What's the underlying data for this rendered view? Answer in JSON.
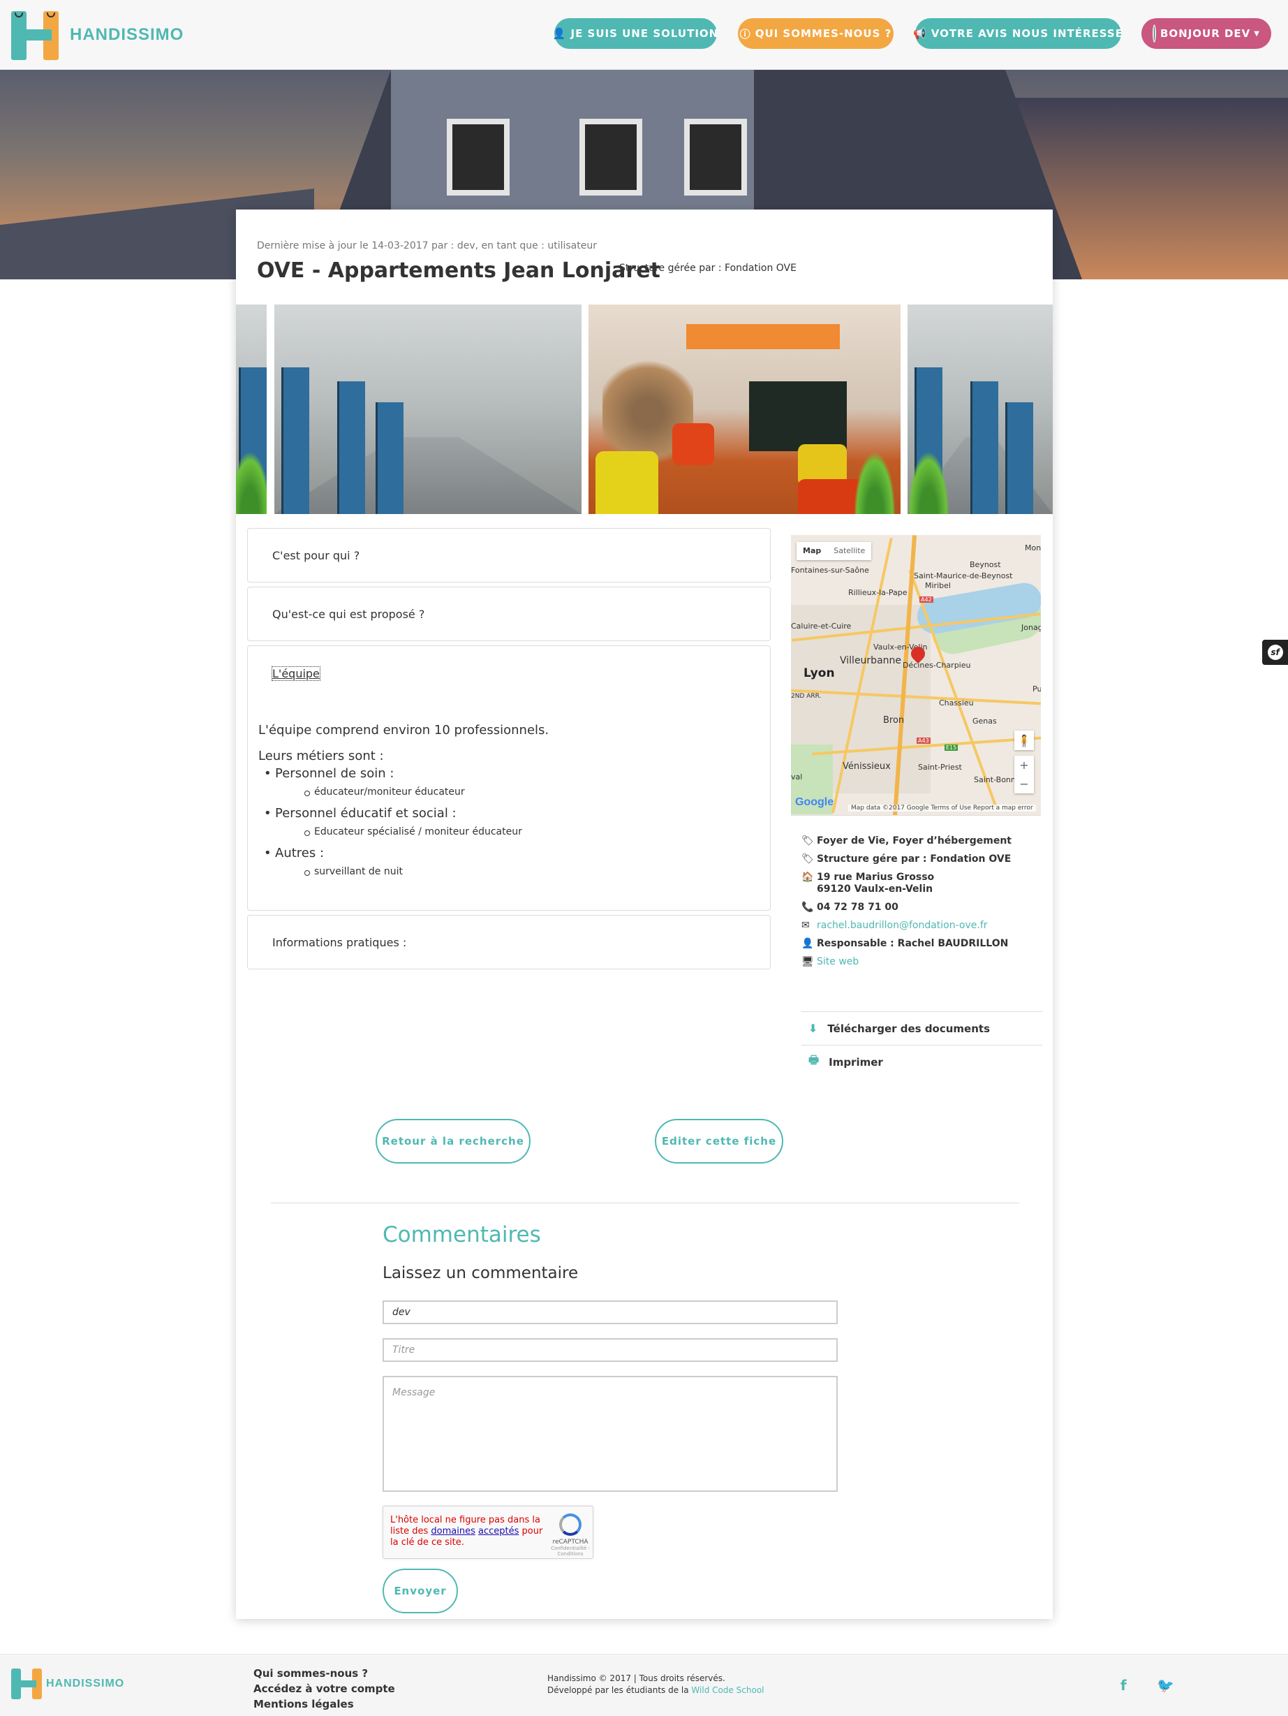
{
  "brand": {
    "name": "HANDISSIMO"
  },
  "nav": {
    "solution": "JE SUIS UNE SOLUTION",
    "about": "QUI SOMMES-NOUS ?",
    "feedback": "VOTRE AVIS NOUS INTÉRESSE",
    "user": "BONJOUR DEV"
  },
  "fiche": {
    "updated": "Dernière mise à jour le 14-03-2017 par : dev, en tant que : utilisateur",
    "title": "OVE - Appartements Jean Lonjaret",
    "managed_by": "Structure gérée par : Fondation OVE"
  },
  "accordion": {
    "who": "C'est pour qui ?",
    "offer": "Qu'est-ce qui est proposé ?",
    "team": "L'équipe",
    "practical": "Informations pratiques :"
  },
  "team": {
    "intro": "L'équipe comprend environ 10 professionnels.",
    "jobs_label": "Leurs métiers sont :",
    "roles": [
      {
        "name": "Personnel de soin :",
        "detail": "éducateur/moniteur éducateur"
      },
      {
        "name": "Personnel éducatif et social :",
        "detail": "Educateur spécialisé / moniteur éducateur"
      },
      {
        "name": "Autres :",
        "detail": "surveillant de nuit"
      }
    ]
  },
  "map": {
    "type_map": "Map",
    "type_satellite": "Satellite",
    "labels": {
      "fontaines": "Fontaines-sur-Saône",
      "beynost": "Beynost",
      "st_maurice": "Saint-Maurice-de-Beynost",
      "miribel": "Miribel",
      "rillieux": "Rillieux-la-Pape",
      "caluire": "Caluire-et-Cuire",
      "jonage": "Jonag",
      "vaulx": "Vaulx-en-Velin",
      "villeurbanne": "Villeurbanne",
      "decines": "Décines-Charpieu",
      "lyon": "Lyon",
      "arr": "2ND ARR.",
      "chassieu": "Chassieu",
      "bron": "Bron",
      "genas": "Genas",
      "venissieux": "Vénissieux",
      "st_priest": "Saint-Priest",
      "st_bonnet": "Saint-Bonne",
      "mon": "Mon",
      "pu": "Pu",
      "val": "val",
      "a42": "A42",
      "a43": "A43",
      "e15": "E15"
    },
    "zoom_in": "+",
    "zoom_out": "−",
    "google": "Google",
    "attribution": "Map data ©2017 Google    Terms of Use    Report a map error"
  },
  "info": {
    "category": "Foyer de Vie, Foyer d’hébergement",
    "structure": "Structure gére par : Fondation OVE",
    "address1": "19 rue Marius Grosso",
    "address2": "69120 Vaulx-en-Velin",
    "phone": "04 72 78 71 00",
    "email": "rachel.baudrillon@fondation-ove.fr",
    "manager": "Responsable : Rachel BAUDRILLON",
    "website": "Site web"
  },
  "actions": {
    "download": "Télécharger des documents",
    "print": "Imprimer"
  },
  "buttons": {
    "back": "Retour à la recherche",
    "edit": "Editer cette fiche",
    "send": "Envoyer"
  },
  "comments": {
    "title": "Commentaires",
    "leave": "Laissez un commentaire",
    "name_value": "dev",
    "title_placeholder": "Titre",
    "message_placeholder": "Message"
  },
  "captcha": {
    "err1": "L'hôte local ne figure pas dans la liste des ",
    "link1": "domaines",
    "link2": "acceptés",
    "err2": " pour la clé de ce site.",
    "brand": "reCAPTCHA",
    "terms": "Confidentialité - Conditions"
  },
  "footer": {
    "brand": "HANDISSIMO",
    "links": [
      "Qui sommes-nous ?",
      "Accédez à votre compte",
      "Mentions légales"
    ],
    "copyright": "Handissimo © 2017 | Tous droits réservés.",
    "dev_prefix": "Développé par les étudiants de la ",
    "dev_school": "Wild Code School",
    "facebook": "f",
    "twitter": "🐦"
  },
  "symfony": {
    "glyph": "sf"
  },
  "colors": {
    "teal": "#4fb8b2",
    "orange": "#f3a742",
    "pink": "#c9577f"
  }
}
